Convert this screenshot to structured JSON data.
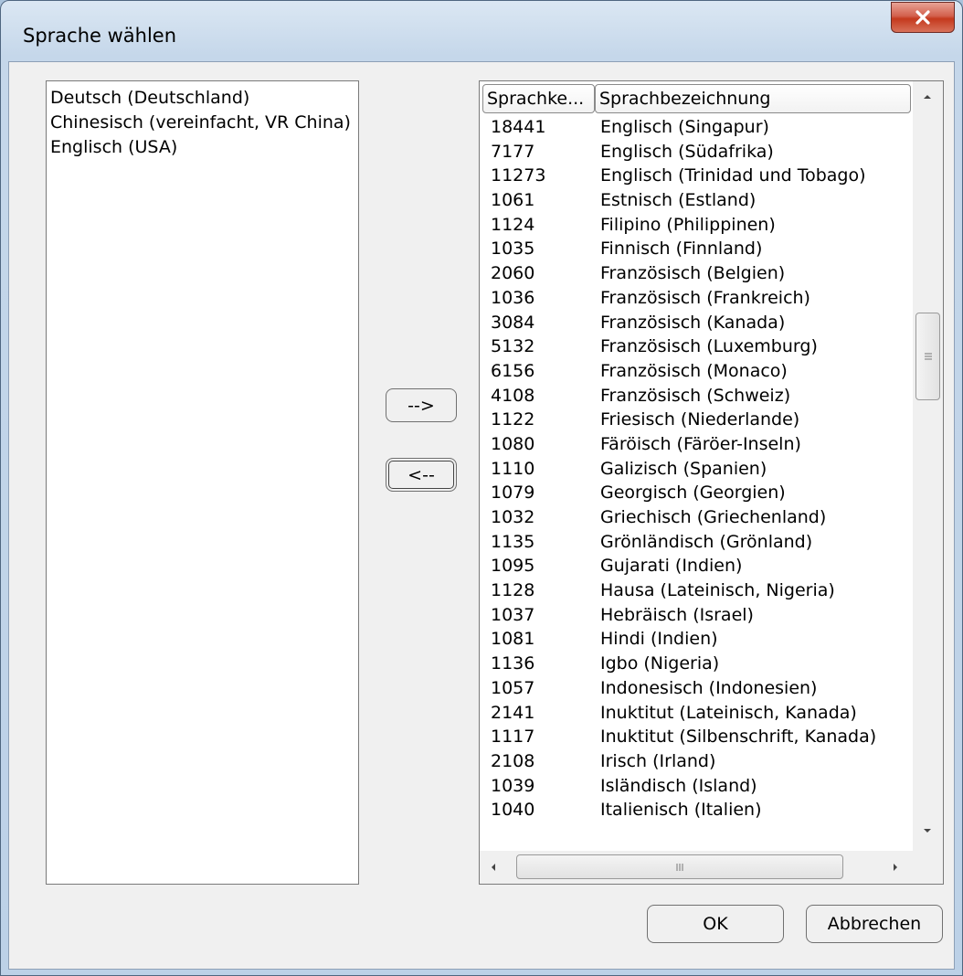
{
  "window": {
    "title": "Sprache wählen"
  },
  "selected_languages": [
    "Deutsch (Deutschland)",
    "Chinesisch (vereinfacht, VR China)",
    "Englisch (USA)"
  ],
  "move_buttons": {
    "add_label": "-->",
    "remove_label": "<--"
  },
  "grid": {
    "columns": [
      "Sprachke...",
      "Sprachbezeichnung"
    ],
    "rows": [
      [
        "18441",
        "Englisch (Singapur)"
      ],
      [
        "7177",
        "Englisch (Südafrika)"
      ],
      [
        "11273",
        "Englisch (Trinidad und Tobago)"
      ],
      [
        "1061",
        "Estnisch (Estland)"
      ],
      [
        "1124",
        "Filipino (Philippinen)"
      ],
      [
        "1035",
        "Finnisch (Finnland)"
      ],
      [
        "2060",
        "Französisch (Belgien)"
      ],
      [
        "1036",
        "Französisch (Frankreich)"
      ],
      [
        "3084",
        "Französisch (Kanada)"
      ],
      [
        "5132",
        "Französisch (Luxemburg)"
      ],
      [
        "6156",
        "Französisch (Monaco)"
      ],
      [
        "4108",
        "Französisch (Schweiz)"
      ],
      [
        "1122",
        "Friesisch (Niederlande)"
      ],
      [
        "1080",
        "Färöisch (Färöer-Inseln)"
      ],
      [
        "1110",
        "Galizisch (Spanien)"
      ],
      [
        "1079",
        "Georgisch (Georgien)"
      ],
      [
        "1032",
        "Griechisch (Griechenland)"
      ],
      [
        "1135",
        "Grönländisch (Grönland)"
      ],
      [
        "1095",
        "Gujarati (Indien)"
      ],
      [
        "1128",
        "Hausa (Lateinisch, Nigeria)"
      ],
      [
        "1037",
        "Hebräisch (Israel)"
      ],
      [
        "1081",
        "Hindi (Indien)"
      ],
      [
        "1136",
        "Igbo (Nigeria)"
      ],
      [
        "1057",
        "Indonesisch (Indonesien)"
      ],
      [
        "2141",
        "Inuktitut (Lateinisch, Kanada)"
      ],
      [
        "1117",
        "Inuktitut (Silbenschrift, Kanada)"
      ],
      [
        "2108",
        "Irisch (Irland)"
      ],
      [
        "1039",
        "Isländisch (Island)"
      ],
      [
        "1040",
        "Italienisch (Italien)"
      ]
    ]
  },
  "footer": {
    "ok_label": "OK",
    "cancel_label": "Abbrechen"
  },
  "icons": {
    "close": "close-icon",
    "scroll_up": "arrow-up-icon",
    "scroll_down": "arrow-down-icon",
    "scroll_left": "arrow-left-icon",
    "scroll_right": "arrow-right-icon"
  }
}
